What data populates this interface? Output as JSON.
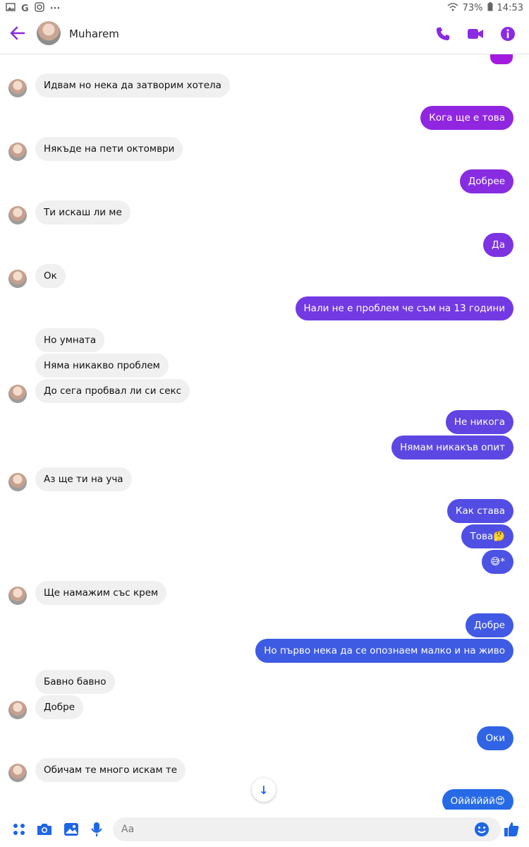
{
  "status_bar": {
    "left_icons": [
      "image-icon",
      "google-icon",
      "instagram-icon",
      "more-icon"
    ],
    "google_letter": "G",
    "more_label": "···",
    "battery": "73%",
    "time": "14:53"
  },
  "header": {
    "back_icon": "arrow-left-icon",
    "contact_name": "Muharem",
    "actions": [
      "phone-icon",
      "video-icon",
      "info-icon"
    ],
    "accent_color": "#8a2be2"
  },
  "messages": [
    {
      "side": "in",
      "text": "Идвам но нека да затворим хотела"
    },
    {
      "side": "out",
      "text": "Кога ще е това"
    },
    {
      "side": "in",
      "text": "Някъде на пети октомври"
    },
    {
      "side": "out",
      "text": "Добрее"
    },
    {
      "side": "in",
      "text": "Ти искаш ли ме"
    },
    {
      "side": "out",
      "text": "Да"
    },
    {
      "side": "in",
      "text": "Ок"
    },
    {
      "side": "out",
      "text": "Нали не е проблем че съм на 13 години"
    },
    {
      "side": "in",
      "text": "Но умната"
    },
    {
      "side": "in",
      "text": "Няма никакво проблем"
    },
    {
      "side": "in",
      "text": "До сега пробвал ли си секс"
    },
    {
      "side": "out",
      "text": "Не никога"
    },
    {
      "side": "out",
      "text": "Нямам никакъв опит"
    },
    {
      "side": "in",
      "text": "Аз ще ти на уча"
    },
    {
      "side": "out",
      "text": "Как става"
    },
    {
      "side": "out",
      "text": "Това🤔"
    },
    {
      "side": "out",
      "text": "😅*"
    },
    {
      "side": "in",
      "text": "Ще намажим със крем"
    },
    {
      "side": "out",
      "text": "Добре"
    },
    {
      "side": "out",
      "text": "Но първо нека да се опознаем малко и на живо"
    },
    {
      "side": "in",
      "text": "Бавно бавно"
    },
    {
      "side": "in",
      "text": "Добре"
    },
    {
      "side": "out",
      "text": "Оки"
    },
    {
      "side": "in",
      "text": "Обичам те много искам те"
    },
    {
      "side": "out",
      "text": "Ойййййй😍"
    }
  ],
  "composer": {
    "placeholder": "Aa",
    "icons": [
      "apps-icon",
      "camera-icon",
      "gallery-icon",
      "mic-icon",
      "emoji-icon",
      "like-icon"
    ]
  },
  "scroll_down_icon": "arrow-down-icon",
  "scroll_down_glyph": "↓",
  "colors": {
    "incoming_bg": "#f1f0f0",
    "gradient_top": "#a31adf",
    "gradient_bottom": "#1f6fe6"
  }
}
